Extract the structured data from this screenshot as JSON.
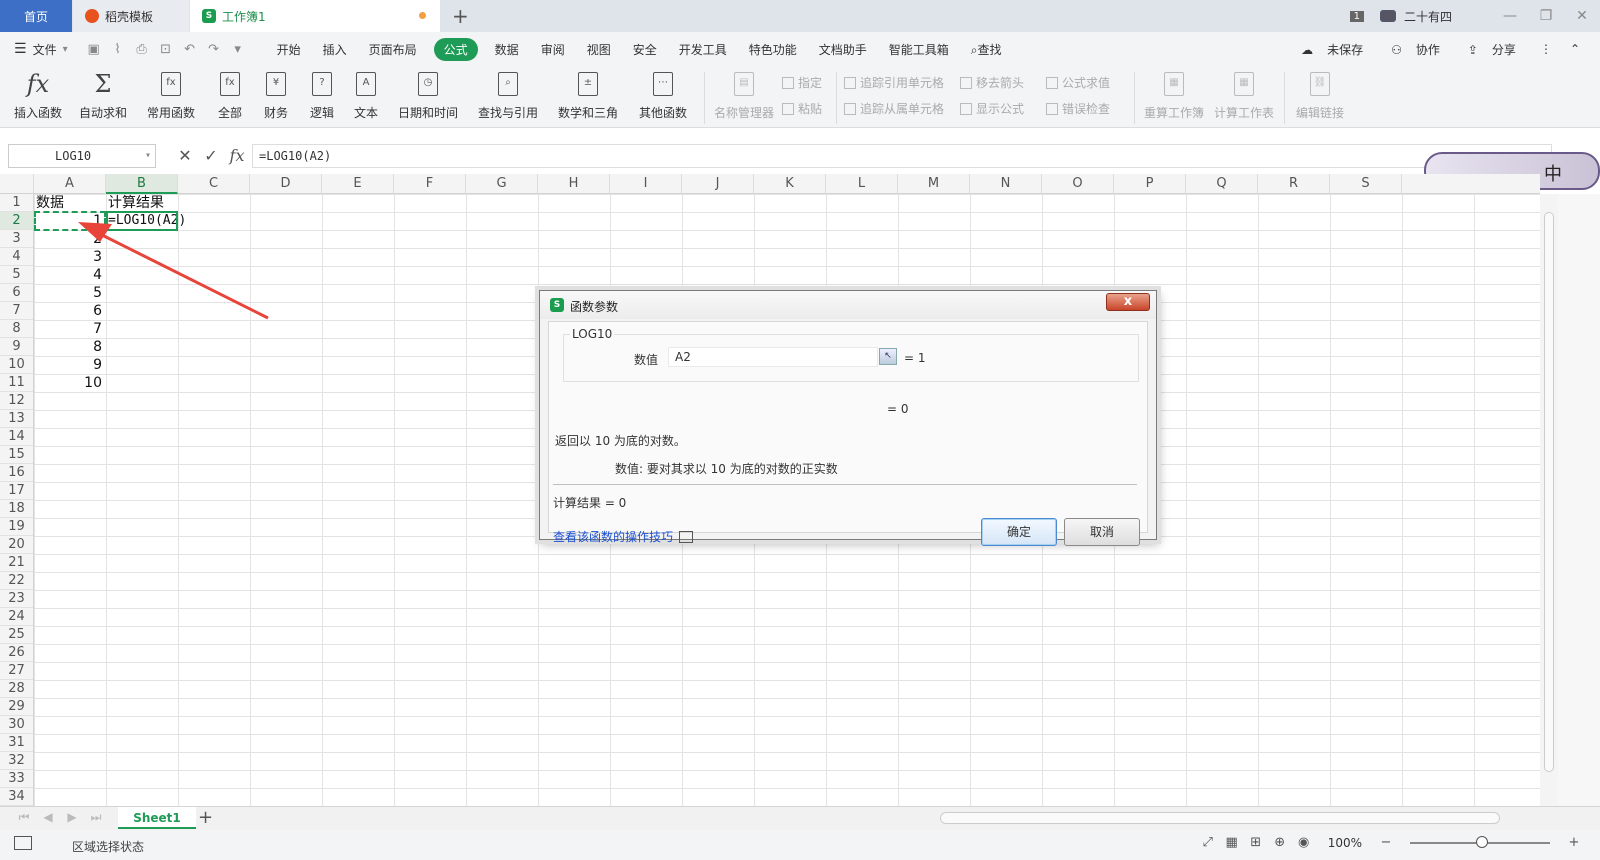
{
  "tabs": {
    "home": "首页",
    "template": "稻壳模板",
    "workbook": "工作簿1",
    "badge": "1",
    "user": "二十有四"
  },
  "menu": {
    "file": "文件",
    "items": [
      "开始",
      "插入",
      "页面布局",
      "公式",
      "数据",
      "审阅",
      "视图",
      "安全",
      "开发工具",
      "特色功能",
      "文档助手",
      "智能工具箱",
      "查找"
    ],
    "active": "公式",
    "right": [
      "未保存",
      "协作",
      "分享"
    ]
  },
  "ribbon": {
    "insert_function": "插入函数",
    "autosum": "自动求和",
    "common": "常用函数",
    "all": "全部",
    "finance": "财务",
    "logic": "逻辑",
    "text": "文本",
    "datetime": "日期和时间",
    "lookup": "查找与引用",
    "math": "数学和三角",
    "other": "其他函数",
    "name_manager": "名称管理器",
    "specify": "指定",
    "paste": "粘贴",
    "trace_precedents": "追踪引用单元格",
    "trace_dependents": "追踪从属单元格",
    "remove_arrows": "移去箭头",
    "show_formulas": "显示公式",
    "evaluate": "公式求值",
    "error_check": "错误检查",
    "recalc_book": "重算工作簿",
    "calc_sheet": "计算工作表",
    "edit_links": "编辑链接"
  },
  "formula_bar": {
    "name_box": "LOG10",
    "formula": "=LOG10(A2)"
  },
  "badge_char": "中",
  "grid": {
    "columns": [
      "A",
      "B",
      "C",
      "D",
      "E",
      "F",
      "G",
      "H",
      "I",
      "J",
      "K",
      "L",
      "M",
      "N",
      "O",
      "P",
      "Q",
      "R",
      "S"
    ],
    "header_A1": "数据",
    "header_B1": "计算结果",
    "values_A": [
      "1",
      "2",
      "3",
      "4",
      "5",
      "6",
      "7",
      "8",
      "9",
      "10"
    ],
    "formula_B2": "=LOG10(A2)"
  },
  "sheets": [
    "Sheet1"
  ],
  "status": {
    "mode": "区域选择状态",
    "zoom": "100%"
  },
  "dialog": {
    "title": "函数参数",
    "close": "x",
    "function_name": "LOG10",
    "arg_label": "数值",
    "arg_value": "A2",
    "arg_result": "= 1",
    "result": "= 0",
    "description": "返回以 10 为底的对数。",
    "arg_desc": "数值:  要对其求以 10 为底的对数的正实数",
    "calc_result": "计算结果  =  0",
    "help_link": "查看该函数的操作技巧",
    "ok": "确定",
    "cancel": "取消"
  },
  "colors": {
    "accent": "#1e9c57",
    "home_tab": "#3d6fc7",
    "arrow": "#e8443a"
  }
}
